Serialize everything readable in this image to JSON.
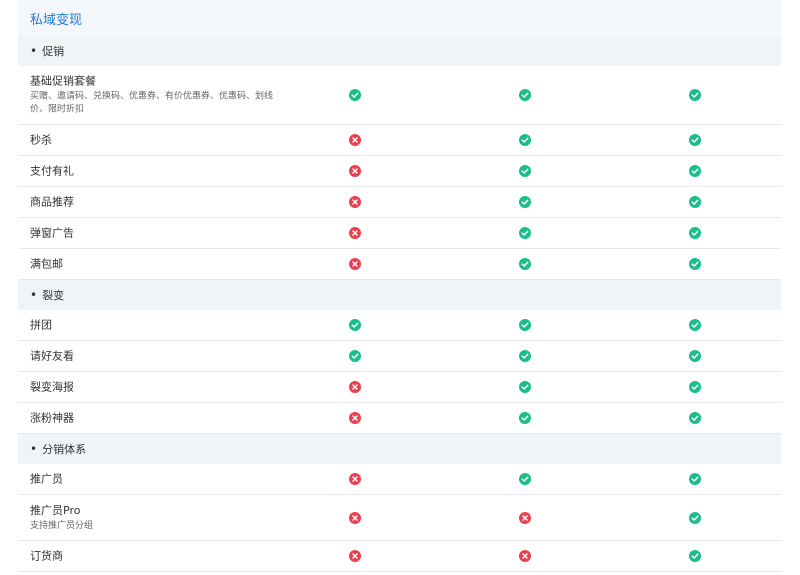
{
  "title": "私域变现",
  "colors": {
    "yes": "#19be8b",
    "no": "#e8404f",
    "title": "#1f78e0"
  },
  "sections": [
    {
      "name": "促销",
      "features": [
        {
          "name": "基础促销套餐",
          "desc": "买赠、邀请码、兑换码、优惠券、有价优惠券、优惠码、划线价、限时折扣",
          "values": [
            true,
            true,
            true
          ]
        },
        {
          "name": "秒杀",
          "desc": "",
          "values": [
            false,
            true,
            true
          ]
        },
        {
          "name": "支付有礼",
          "desc": "",
          "values": [
            false,
            true,
            true
          ]
        },
        {
          "name": "商品推荐",
          "desc": "",
          "values": [
            false,
            true,
            true
          ]
        },
        {
          "name": "弹窗广告",
          "desc": "",
          "values": [
            false,
            true,
            true
          ]
        },
        {
          "name": "满包邮",
          "desc": "",
          "values": [
            false,
            true,
            true
          ]
        }
      ]
    },
    {
      "name": "裂变",
      "features": [
        {
          "name": "拼团",
          "desc": "",
          "values": [
            true,
            true,
            true
          ]
        },
        {
          "name": "请好友看",
          "desc": "",
          "values": [
            true,
            true,
            true
          ]
        },
        {
          "name": "裂变海报",
          "desc": "",
          "values": [
            false,
            true,
            true
          ]
        },
        {
          "name": "涨粉神器",
          "desc": "",
          "values": [
            false,
            true,
            true
          ]
        }
      ]
    },
    {
      "name": "分销体系",
      "features": [
        {
          "name": "推广员",
          "desc": "",
          "values": [
            false,
            true,
            true
          ]
        },
        {
          "name": "推广员Pro",
          "desc": "支持推广员分组",
          "values": [
            false,
            false,
            true
          ]
        },
        {
          "name": "订货商",
          "desc": "",
          "values": [
            false,
            false,
            true
          ]
        }
      ]
    }
  ]
}
